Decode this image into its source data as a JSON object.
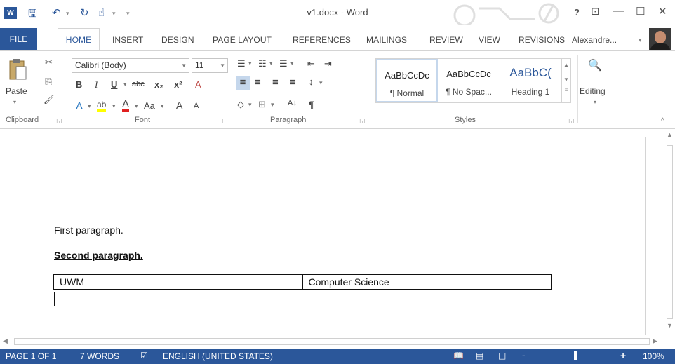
{
  "window": {
    "title": "v1.docx - Word",
    "help": "?",
    "restore_ribbon": "⊡",
    "minimize": "—",
    "maximize": "☐",
    "close": "✕"
  },
  "quick_access": {
    "app_icon": "W",
    "save": "🖫",
    "undo": "↶",
    "redo": "↻",
    "touch": "☝",
    "customize": "▾"
  },
  "tabs": [
    "FILE",
    "HOME",
    "INSERT",
    "DESIGN",
    "PAGE LAYOUT",
    "REFERENCES",
    "MAILINGS",
    "REVIEW",
    "VIEW",
    "REVISIONS"
  ],
  "user": {
    "name": "Alexandre...",
    "dropdown": "▾"
  },
  "ribbon": {
    "clipboard": {
      "label": "Clipboard",
      "paste": "Paste",
      "cut_icon": "✂",
      "copy_icon": "⎘",
      "format_painter_icon": "🖌"
    },
    "font": {
      "label": "Font",
      "font_name": "Calibri (Body)",
      "font_size": "11",
      "bold": "B",
      "italic": "I",
      "underline": "U",
      "strikethrough": "abc",
      "subscript": "x₂",
      "superscript": "x²",
      "clear": "A",
      "text_effects": "A",
      "highlight": "ab",
      "font_color": "A",
      "change_case": "Aa",
      "grow": "A",
      "shrink": "A"
    },
    "paragraph": {
      "label": "Paragraph",
      "bullets": "☰",
      "numbering": "☷",
      "multilevel": "☰",
      "decrease_indent": "⇤",
      "increase_indent": "⇥",
      "align_left": "≡",
      "center": "≡",
      "align_right": "≡",
      "justify": "≡",
      "line_spacing": "↕",
      "shading": "◇",
      "borders": "⊞",
      "sort": "A↓",
      "show_marks": "¶"
    },
    "styles": {
      "label": "Styles",
      "items": [
        {
          "sample": "AaBbCcDc",
          "name": "¶ Normal"
        },
        {
          "sample": "AaBbCcDc",
          "name": "¶ No Spac..."
        },
        {
          "sample": "AaBbC(",
          "name": "Heading 1"
        }
      ]
    },
    "editing": {
      "label": "Editing",
      "icon": "🔍"
    }
  },
  "document": {
    "paragraph1": "First paragraph.",
    "paragraph2": "Second paragraph.",
    "table": [
      [
        "UWM",
        "Computer Science"
      ]
    ]
  },
  "status": {
    "page": "PAGE 1 OF 1",
    "words": "7 WORDS",
    "language": "ENGLISH (UNITED STATES)",
    "zoom": "100%",
    "zoom_minus": "-",
    "zoom_plus": "+",
    "zoom_fraction": 0.5
  },
  "colors": {
    "accent": "#2b579a"
  }
}
